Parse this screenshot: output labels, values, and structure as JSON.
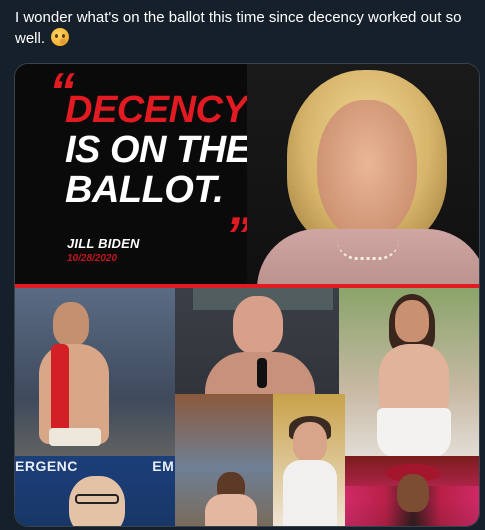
{
  "tweet": {
    "text": "I wonder what's on the ballot this time since decency worked out so well.",
    "emoji_icon": "thinking-face-icon"
  },
  "poster": {
    "quote_open": "“",
    "quote_close": "”",
    "headline_line1": "DECENCY",
    "headline_line2": "IS ON THE",
    "headline_line3": "BALLOT.",
    "attribution": "JILL BIDEN",
    "date": "10/28/2020",
    "colors": {
      "accent_red": "#e21a22",
      "background": "#0a0a0a",
      "headline_white": "#ffffff"
    }
  },
  "collage": {
    "sign_text": "ERGENC",
    "sign_text_2": "EM"
  },
  "page": {
    "background": "#15202b"
  }
}
